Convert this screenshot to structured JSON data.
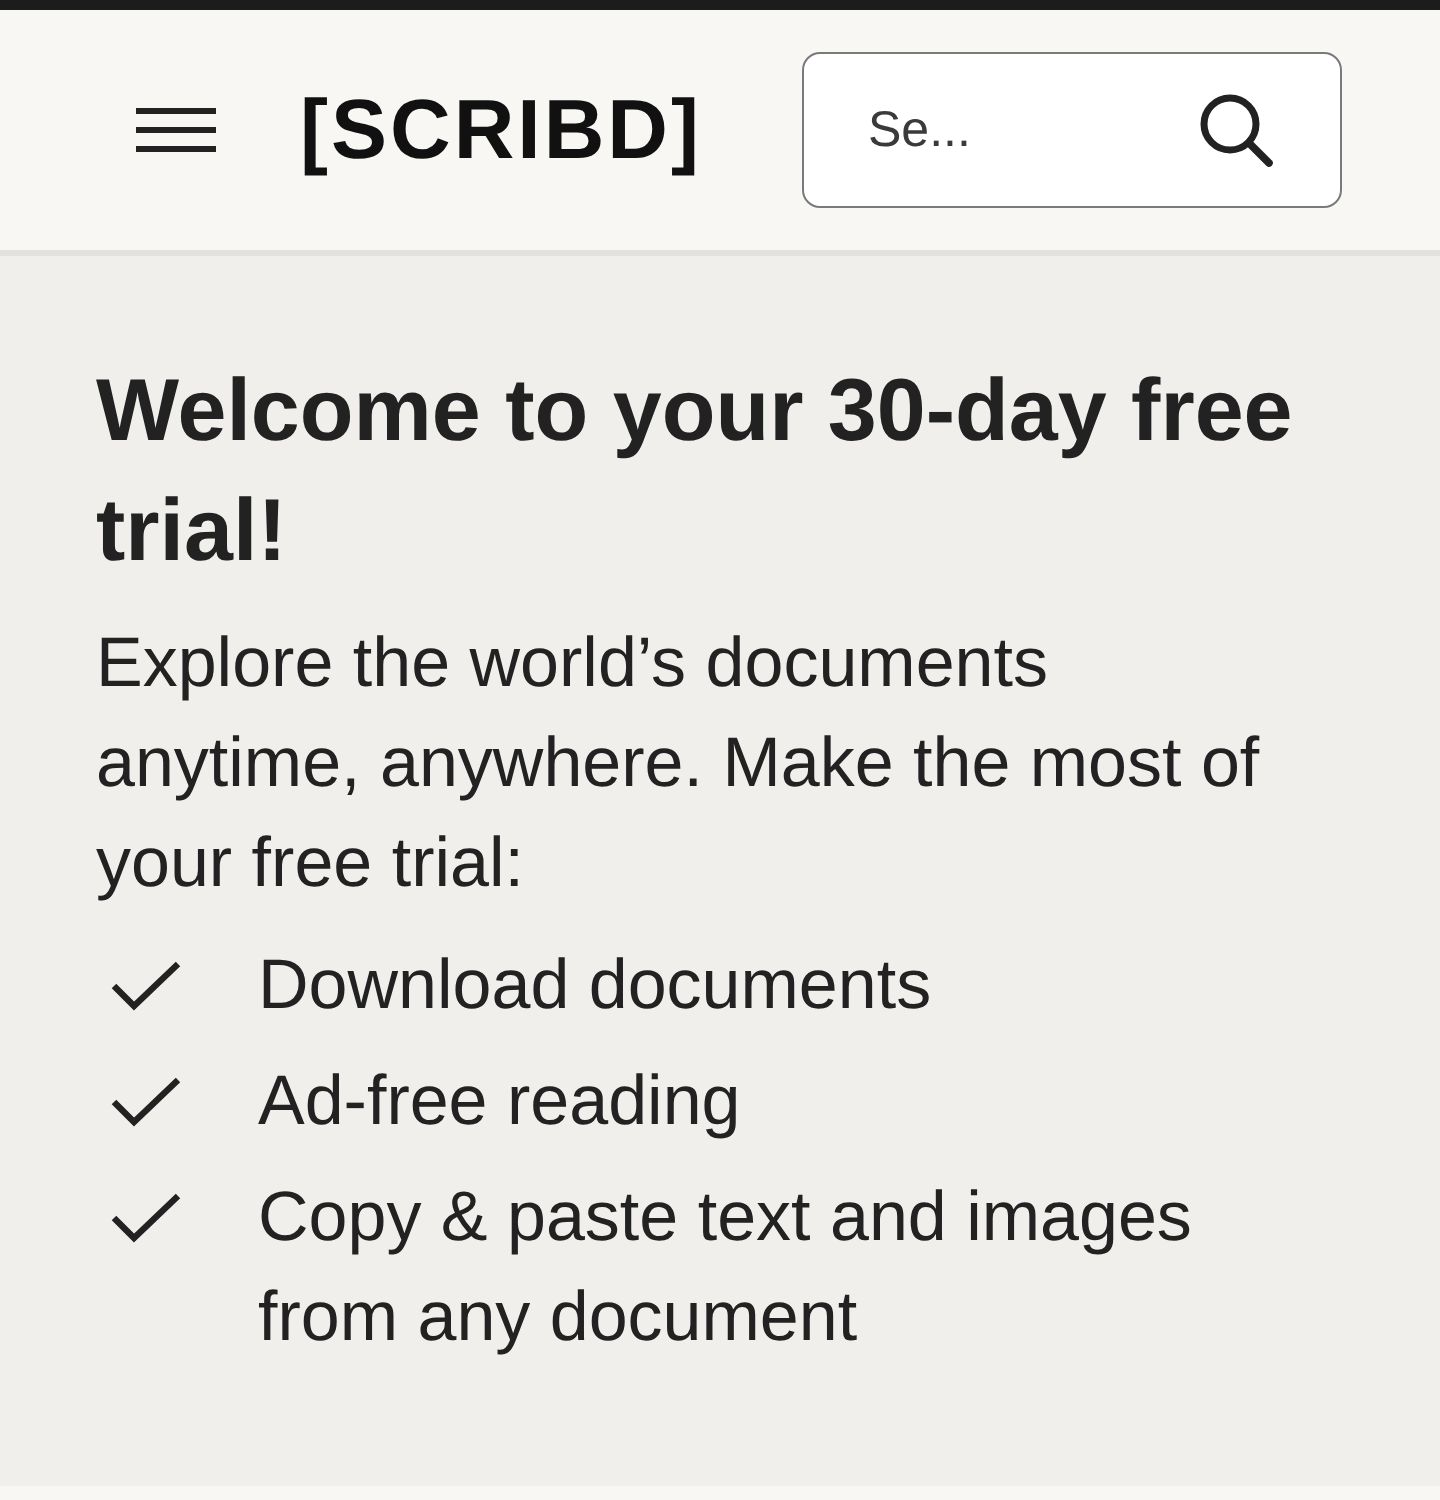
{
  "header": {
    "logo": "[SCRIBD]",
    "search": {
      "placeholder": "Se..."
    }
  },
  "welcome": {
    "title": "Welcome to your 30-day free trial!",
    "intro": "Explore the world’s documents anytime, anywhere. Make the most of your free trial:",
    "benefits": [
      {
        "text": "Download documents"
      },
      {
        "text": "Ad-free reading"
      },
      {
        "text": "Copy & paste text and images from any document"
      }
    ]
  }
}
